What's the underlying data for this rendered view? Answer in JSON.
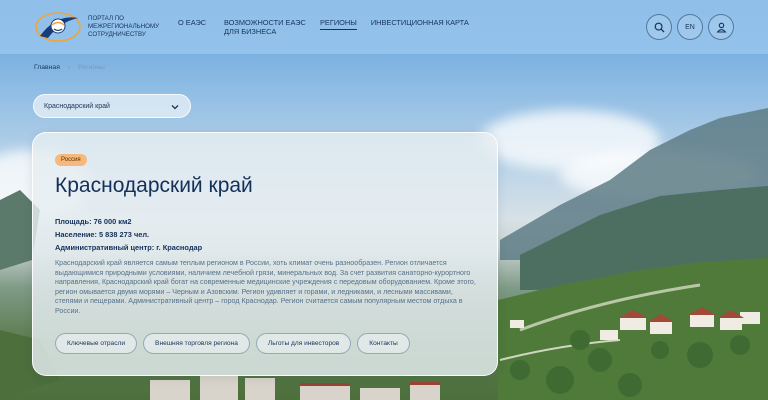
{
  "header": {
    "logo_text": "Портал по межрегиональному сотрудничеству",
    "nav": [
      {
        "label": "О ЕАЭС",
        "active": false
      },
      {
        "label": "Возможности ЕАЭС для бизнеса",
        "active": false
      },
      {
        "label": "Регионы",
        "active": true
      },
      {
        "label": "Инвестиционная карта",
        "active": false
      }
    ],
    "search_icon": "search-icon",
    "language": "EN",
    "profile_icon": "user-icon"
  },
  "breadcrumb": {
    "home": "Главная",
    "separator": "›",
    "current": "Регионы"
  },
  "region_select": {
    "value": "Краснодарский край",
    "icon": "chevron-down-icon"
  },
  "region": {
    "country_badge": "Россия",
    "title": "Краснодарский край",
    "area": "Площадь: 76 000 км2",
    "population": "Население: 5 838 273 чел.",
    "center": "Административный центр: г. Краснодар",
    "description": "Краснодарский край является самым теплым регионом в России, хоть климат очень разнообразен. Регион отличается выдающимися природными условиями, наличием лечебной грязи, минеральных вод. За счет развития санаторно-курортного направления, Краснодарский край богат на современные медицинские учреждения с передовым оборудованием. Кроме этого, регион омывается двумя морями – Черным и Азовским. Регион удивляет и горами, и ледниками, и лесными массивами, степями и пещерами. Административный центр – город Краснодар. Регион считается самым популярным местом отдыха в России.",
    "chips": [
      "Ключевые отрасли",
      "Внешняя торговля региона",
      "Льготы для инвесторов",
      "Контакты"
    ]
  },
  "colors": {
    "accent": "#14305a",
    "badge": "#f6b97b"
  }
}
